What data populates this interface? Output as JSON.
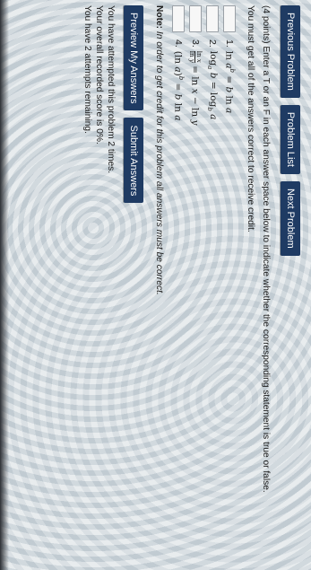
{
  "nav": {
    "previous": "Previous Problem",
    "list": "Problem List",
    "next": "Next Problem"
  },
  "problem": {
    "points": "(4 points)",
    "instruction": "Enter a T or an F in each answer space below to indicate whether the corresponding statement is true or false.",
    "must_correct": "You must get all of the answers correct to receive credit.",
    "statements": [
      {
        "num": "1.",
        "text": "ln a^b = b ln a"
      },
      {
        "num": "2.",
        "text": "log_a b = log_b a"
      },
      {
        "num": "3.",
        "text": "ln x / ln y = ln x − ln y"
      },
      {
        "num": "4.",
        "text": "(ln a)^b = b ln a"
      }
    ]
  },
  "note": {
    "label": "Note:",
    "text": "In order to get credit for this problem all answers must be correct."
  },
  "actions": {
    "preview": "Preview My Answers",
    "submit": "Submit Answers"
  },
  "status": {
    "attempted": "You have attempted this problem 2 times.",
    "score": "Your overall recorded score is 0%.",
    "remaining": "You have 2 attempts remaining."
  }
}
